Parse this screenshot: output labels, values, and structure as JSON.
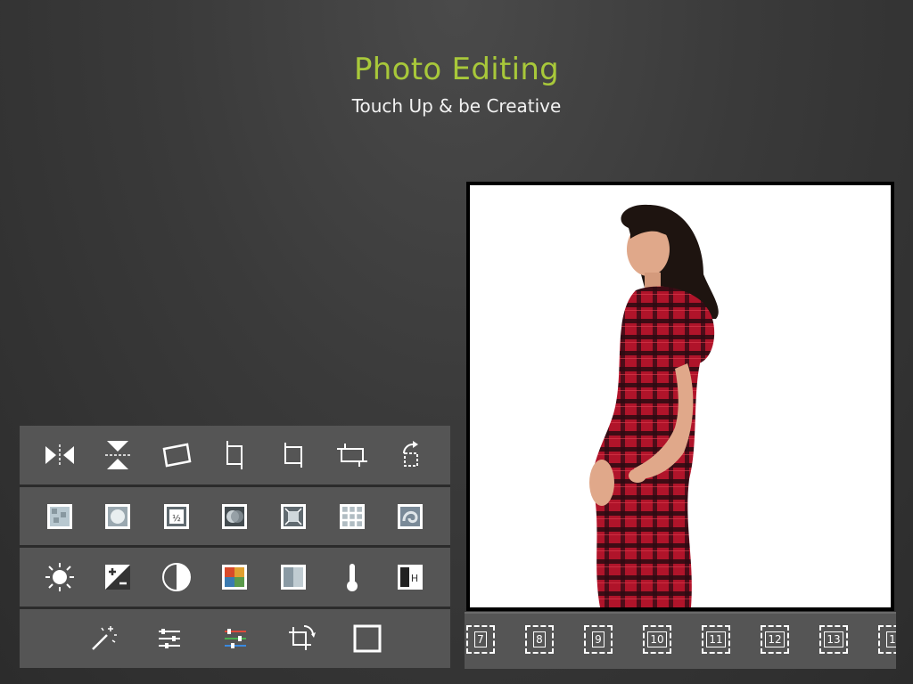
{
  "header": {
    "title": "Photo Editing",
    "subtitle": "Touch Up & be Creative"
  },
  "colors": {
    "title": "#a8c83a",
    "panel": "#555555",
    "background": "#3a3a3a"
  },
  "tools": {
    "row1": [
      "flip-horizontal-icon",
      "flip-vertical-icon",
      "rotate-photo-icon",
      "crop-free-icon",
      "crop-square-icon",
      "crop-wide-icon",
      "rotate-back-icon"
    ],
    "row2": [
      "texture-icon",
      "vignette-icon",
      "frame-style-icon",
      "overlay-icon",
      "focus-icon",
      "grid-icon",
      "swirl-icon"
    ],
    "row3": [
      "brightness-icon",
      "exposure-icon",
      "contrast-icon",
      "saturation-icon",
      "tint-icon",
      "temperature-icon",
      "highlights-icon"
    ],
    "row4": [
      "magic-wand-icon",
      "adjust-sliders-icon",
      "color-balance-icon",
      "crop-rotate-icon",
      "border-icon"
    ]
  },
  "frames": {
    "items": [
      "7",
      "8",
      "9",
      "10",
      "11",
      "12",
      "13",
      "1"
    ]
  },
  "photo": {
    "subject": "woman-in-red-plaid-dress"
  }
}
